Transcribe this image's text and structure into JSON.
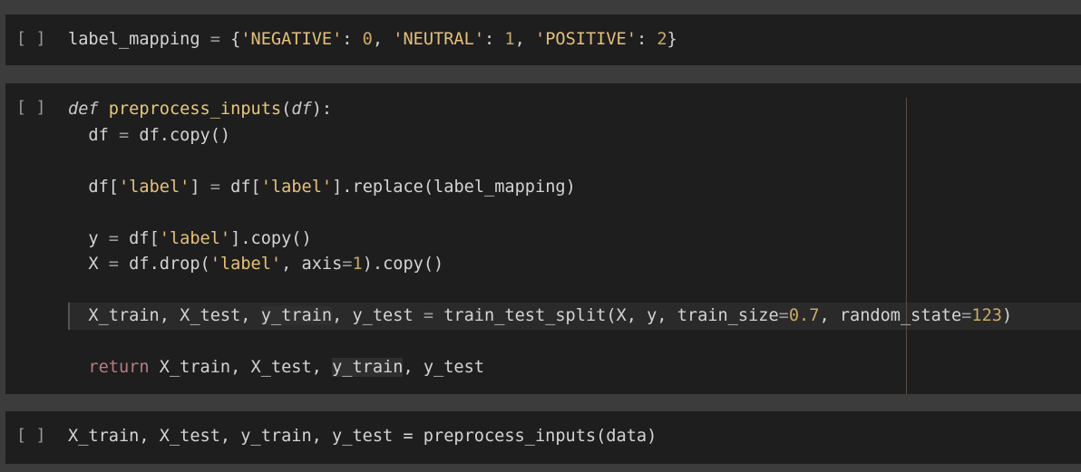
{
  "cells": [
    {
      "run_indicator": "[ ]",
      "lines": [
        "label_mapping = {'NEGATIVE': 0, 'NEUTRAL': 1, 'POSITIVE': 2}"
      ]
    },
    {
      "run_indicator": "[ ]",
      "lines": [
        "def preprocess_inputs(df):",
        "  df = df.copy()",
        "",
        "  df['label'] = df['label'].replace(label_mapping)",
        "",
        "  y = df['label'].copy()",
        "  X = df.drop('label', axis=1).copy()",
        "",
        "  X_train, X_test, y_train, y_test = train_test_split(X, y, train_size=0.7, random_state=123)",
        "",
        "  return X_train, X_test, y_train, y_test"
      ]
    },
    {
      "run_indicator": "[ ]",
      "lines": [
        "X_train, X_test, y_train, y_test = preprocess_inputs(data)"
      ]
    }
  ],
  "colors": {
    "background": "#3c3c3c",
    "cell_background": "#1e1e1e",
    "string": "#e5c07b",
    "number": "#c9a968",
    "keyword_return": "#b87c7c"
  }
}
